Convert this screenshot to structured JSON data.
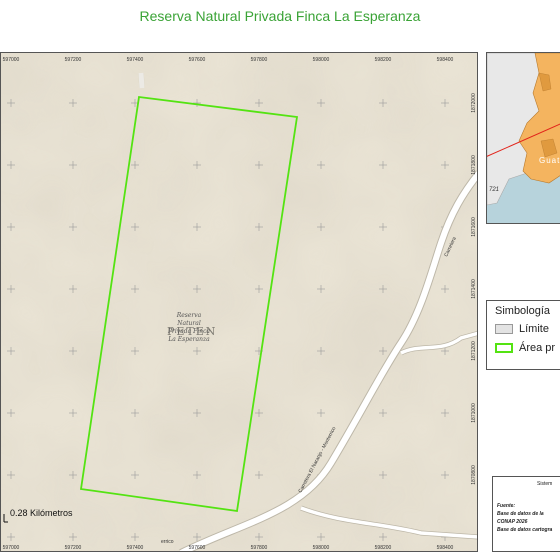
{
  "map": {
    "title": "Reserva Natural Privada Finca La Esperanza",
    "reserve_label": [
      "Reserva",
      "Natural",
      "Privada Finca",
      "La Esperanza"
    ],
    "region_label": "PETEN",
    "road_labels": [
      "Carretera El Naranjo - Monterrico",
      "Carretera",
      "errico"
    ],
    "x_ticks": [
      "597000",
      "597200",
      "597400",
      "597600",
      "597800",
      "598000",
      "598200",
      "598400"
    ],
    "y_ticks": [
      "1872000",
      "1871800",
      "1871600",
      "1871400",
      "1871200",
      "1871000",
      "1870800"
    ],
    "scale_text": "0.28 Kilómetros",
    "inset_country_label": "Guate",
    "inset_marker_label": "721"
  },
  "legend": {
    "title": "Simbología",
    "items": [
      {
        "label": "Límite",
        "swatch": "limit"
      },
      {
        "label": "Área pr",
        "swatch": "area"
      }
    ]
  },
  "info": {
    "header": "Sistem",
    "lines": [
      {
        "text": "Fuente:",
        "bold": true
      },
      {
        "text": "Base de datos de la",
        "bold": true
      },
      {
        "text": "CONAP 2026",
        "bold": true
      },
      {
        "text": "Base de datos cartogra",
        "bold": true
      }
    ]
  },
  "colors": {
    "title": "#3aa336",
    "boundary": "#54e312",
    "terrain": "#e9e3d4",
    "water": "#b7d3dc",
    "land": "#f4b45f"
  }
}
